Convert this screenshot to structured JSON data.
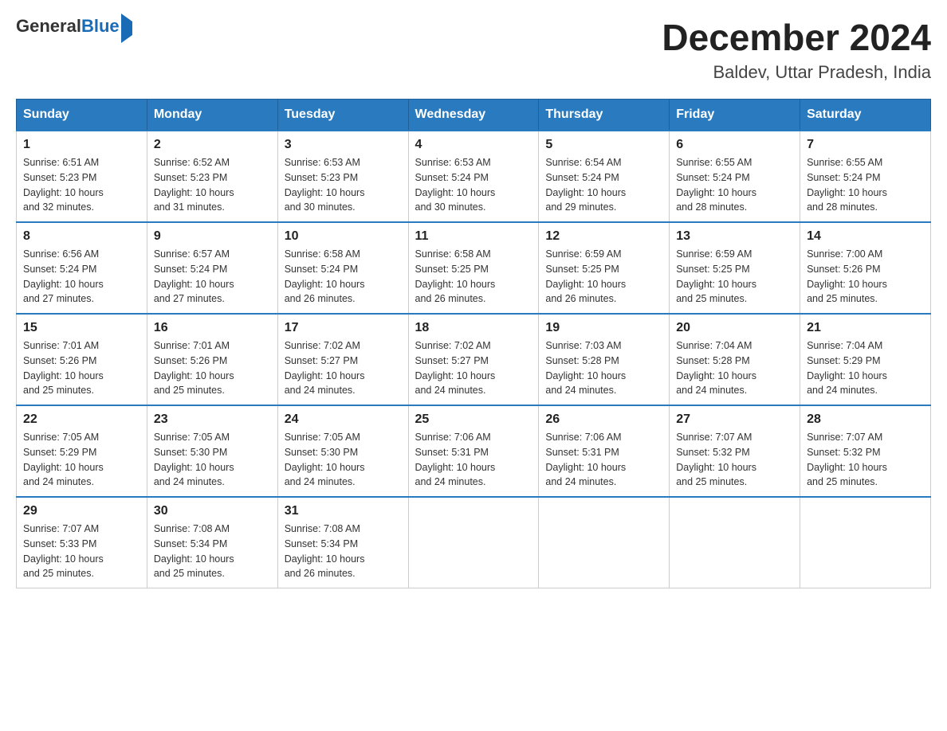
{
  "header": {
    "logo_general": "General",
    "logo_blue": "Blue",
    "title": "December 2024",
    "subtitle": "Baldev, Uttar Pradesh, India"
  },
  "days_of_week": [
    "Sunday",
    "Monday",
    "Tuesday",
    "Wednesday",
    "Thursday",
    "Friday",
    "Saturday"
  ],
  "weeks": [
    [
      {
        "day": "1",
        "sunrise": "6:51 AM",
        "sunset": "5:23 PM",
        "daylight": "10 hours and 32 minutes."
      },
      {
        "day": "2",
        "sunrise": "6:52 AM",
        "sunset": "5:23 PM",
        "daylight": "10 hours and 31 minutes."
      },
      {
        "day": "3",
        "sunrise": "6:53 AM",
        "sunset": "5:23 PM",
        "daylight": "10 hours and 30 minutes."
      },
      {
        "day": "4",
        "sunrise": "6:53 AM",
        "sunset": "5:24 PM",
        "daylight": "10 hours and 30 minutes."
      },
      {
        "day": "5",
        "sunrise": "6:54 AM",
        "sunset": "5:24 PM",
        "daylight": "10 hours and 29 minutes."
      },
      {
        "day": "6",
        "sunrise": "6:55 AM",
        "sunset": "5:24 PM",
        "daylight": "10 hours and 28 minutes."
      },
      {
        "day": "7",
        "sunrise": "6:55 AM",
        "sunset": "5:24 PM",
        "daylight": "10 hours and 28 minutes."
      }
    ],
    [
      {
        "day": "8",
        "sunrise": "6:56 AM",
        "sunset": "5:24 PM",
        "daylight": "10 hours and 27 minutes."
      },
      {
        "day": "9",
        "sunrise": "6:57 AM",
        "sunset": "5:24 PM",
        "daylight": "10 hours and 27 minutes."
      },
      {
        "day": "10",
        "sunrise": "6:58 AM",
        "sunset": "5:24 PM",
        "daylight": "10 hours and 26 minutes."
      },
      {
        "day": "11",
        "sunrise": "6:58 AM",
        "sunset": "5:25 PM",
        "daylight": "10 hours and 26 minutes."
      },
      {
        "day": "12",
        "sunrise": "6:59 AM",
        "sunset": "5:25 PM",
        "daylight": "10 hours and 26 minutes."
      },
      {
        "day": "13",
        "sunrise": "6:59 AM",
        "sunset": "5:25 PM",
        "daylight": "10 hours and 25 minutes."
      },
      {
        "day": "14",
        "sunrise": "7:00 AM",
        "sunset": "5:26 PM",
        "daylight": "10 hours and 25 minutes."
      }
    ],
    [
      {
        "day": "15",
        "sunrise": "7:01 AM",
        "sunset": "5:26 PM",
        "daylight": "10 hours and 25 minutes."
      },
      {
        "day": "16",
        "sunrise": "7:01 AM",
        "sunset": "5:26 PM",
        "daylight": "10 hours and 25 minutes."
      },
      {
        "day": "17",
        "sunrise": "7:02 AM",
        "sunset": "5:27 PM",
        "daylight": "10 hours and 24 minutes."
      },
      {
        "day": "18",
        "sunrise": "7:02 AM",
        "sunset": "5:27 PM",
        "daylight": "10 hours and 24 minutes."
      },
      {
        "day": "19",
        "sunrise": "7:03 AM",
        "sunset": "5:28 PM",
        "daylight": "10 hours and 24 minutes."
      },
      {
        "day": "20",
        "sunrise": "7:04 AM",
        "sunset": "5:28 PM",
        "daylight": "10 hours and 24 minutes."
      },
      {
        "day": "21",
        "sunrise": "7:04 AM",
        "sunset": "5:29 PM",
        "daylight": "10 hours and 24 minutes."
      }
    ],
    [
      {
        "day": "22",
        "sunrise": "7:05 AM",
        "sunset": "5:29 PM",
        "daylight": "10 hours and 24 minutes."
      },
      {
        "day": "23",
        "sunrise": "7:05 AM",
        "sunset": "5:30 PM",
        "daylight": "10 hours and 24 minutes."
      },
      {
        "day": "24",
        "sunrise": "7:05 AM",
        "sunset": "5:30 PM",
        "daylight": "10 hours and 24 minutes."
      },
      {
        "day": "25",
        "sunrise": "7:06 AM",
        "sunset": "5:31 PM",
        "daylight": "10 hours and 24 minutes."
      },
      {
        "day": "26",
        "sunrise": "7:06 AM",
        "sunset": "5:31 PM",
        "daylight": "10 hours and 24 minutes."
      },
      {
        "day": "27",
        "sunrise": "7:07 AM",
        "sunset": "5:32 PM",
        "daylight": "10 hours and 25 minutes."
      },
      {
        "day": "28",
        "sunrise": "7:07 AM",
        "sunset": "5:32 PM",
        "daylight": "10 hours and 25 minutes."
      }
    ],
    [
      {
        "day": "29",
        "sunrise": "7:07 AM",
        "sunset": "5:33 PM",
        "daylight": "10 hours and 25 minutes."
      },
      {
        "day": "30",
        "sunrise": "7:08 AM",
        "sunset": "5:34 PM",
        "daylight": "10 hours and 25 minutes."
      },
      {
        "day": "31",
        "sunrise": "7:08 AM",
        "sunset": "5:34 PM",
        "daylight": "10 hours and 26 minutes."
      },
      null,
      null,
      null,
      null
    ]
  ],
  "labels": {
    "sunrise": "Sunrise:",
    "sunset": "Sunset:",
    "daylight": "Daylight:"
  }
}
